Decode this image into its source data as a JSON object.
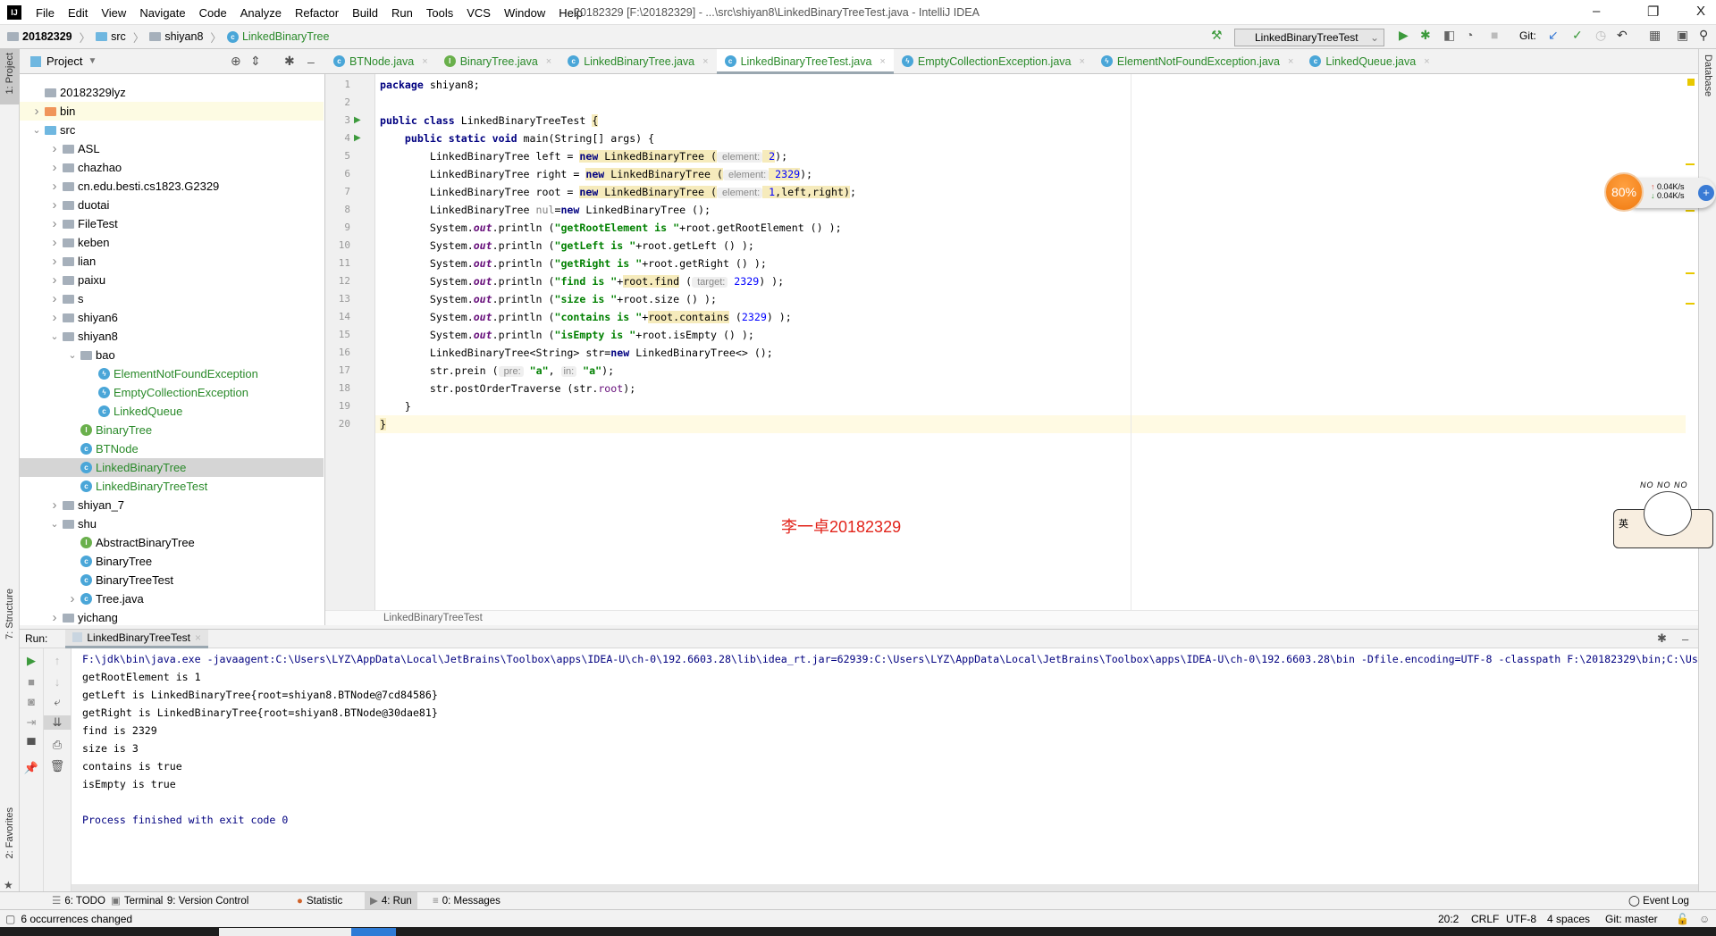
{
  "titlebar": {
    "logo": "IJ",
    "menus": [
      "File",
      "Edit",
      "View",
      "Navigate",
      "Code",
      "Analyze",
      "Refactor",
      "Build",
      "Run",
      "Tools",
      "VCS",
      "Window",
      "Help"
    ],
    "title": "20182329 [F:\\20182329] - ...\\src\\shiyan8\\LinkedBinaryTreeTest.java - IntelliJ IDEA",
    "controls": {
      "minimize": "–",
      "restore": "❐",
      "close": "X"
    }
  },
  "navbar": {
    "crumbs": [
      "20182329",
      "src",
      "shiyan8",
      "LinkedBinaryTree"
    ],
    "run_config": "LinkedBinaryTreeTest",
    "git_label": "Git:"
  },
  "sidebar": {
    "left_tools": [
      "1: Project",
      "7: Structure",
      "2: Favorites"
    ],
    "right_tools": [
      "Database"
    ]
  },
  "project": {
    "title": "Project",
    "items": [
      {
        "label": "20182329lyz",
        "depth": 1,
        "arrow": "",
        "icon": "folder"
      },
      {
        "label": "bin",
        "depth": 1,
        "arrow": "right",
        "icon": "folder-orange",
        "highlight": true
      },
      {
        "label": "src",
        "depth": 1,
        "arrow": "down",
        "icon": "folder-blue"
      },
      {
        "label": "ASL",
        "depth": 2,
        "arrow": "right",
        "icon": "package"
      },
      {
        "label": "chazhao",
        "depth": 2,
        "arrow": "right",
        "icon": "package"
      },
      {
        "label": "cn.edu.besti.cs1823.G2329",
        "depth": 2,
        "arrow": "right",
        "icon": "package"
      },
      {
        "label": "duotai",
        "depth": 2,
        "arrow": "right",
        "icon": "package"
      },
      {
        "label": "FileTest",
        "depth": 2,
        "arrow": "right",
        "icon": "package"
      },
      {
        "label": "keben",
        "depth": 2,
        "arrow": "right",
        "icon": "package"
      },
      {
        "label": "lian",
        "depth": 2,
        "arrow": "right",
        "icon": "package"
      },
      {
        "label": "paixu",
        "depth": 2,
        "arrow": "right",
        "icon": "package"
      },
      {
        "label": "s",
        "depth": 2,
        "arrow": "right",
        "icon": "package"
      },
      {
        "label": "shiyan6",
        "depth": 2,
        "arrow": "right",
        "icon": "package"
      },
      {
        "label": "shiyan8",
        "depth": 2,
        "arrow": "down",
        "icon": "package"
      },
      {
        "label": "bao",
        "depth": 3,
        "arrow": "down",
        "icon": "package"
      },
      {
        "label": "ElementNotFoundException",
        "depth": 4,
        "arrow": "",
        "icon": "exception",
        "green": true
      },
      {
        "label": "EmptyCollectionException",
        "depth": 4,
        "arrow": "",
        "icon": "exception",
        "green": true
      },
      {
        "label": "LinkedQueue",
        "depth": 4,
        "arrow": "",
        "icon": "class",
        "green": true
      },
      {
        "label": "BinaryTree",
        "depth": 3,
        "arrow": "",
        "icon": "interface",
        "green": true
      },
      {
        "label": "BTNode",
        "depth": 3,
        "arrow": "",
        "icon": "class",
        "green": true
      },
      {
        "label": "LinkedBinaryTree",
        "depth": 3,
        "arrow": "",
        "icon": "class",
        "green": true,
        "selected": true
      },
      {
        "label": "LinkedBinaryTreeTest",
        "depth": 3,
        "arrow": "",
        "icon": "test-class",
        "green": true
      },
      {
        "label": "shiyan_7",
        "depth": 2,
        "arrow": "right",
        "icon": "package"
      },
      {
        "label": "shu",
        "depth": 2,
        "arrow": "down",
        "icon": "package"
      },
      {
        "label": "AbstractBinaryTree",
        "depth": 3,
        "arrow": "",
        "icon": "interface"
      },
      {
        "label": "BinaryTree",
        "depth": 3,
        "arrow": "",
        "icon": "class"
      },
      {
        "label": "BinaryTreeTest",
        "depth": 3,
        "arrow": "",
        "icon": "test-class"
      },
      {
        "label": "Tree.java",
        "depth": 3,
        "arrow": "right",
        "icon": "class"
      },
      {
        "label": "yichang",
        "depth": 2,
        "arrow": "right",
        "icon": "package"
      }
    ]
  },
  "tabs": [
    {
      "label": "BTNode.java",
      "icon": "class"
    },
    {
      "label": "BinaryTree.java",
      "icon": "interface"
    },
    {
      "label": "LinkedBinaryTree.java",
      "icon": "class"
    },
    {
      "label": "LinkedBinaryTreeTest.java",
      "icon": "test-class",
      "active": true
    },
    {
      "label": "EmptyCollectionException.java",
      "icon": "exception"
    },
    {
      "label": "ElementNotFoundException.java",
      "icon": "exception"
    },
    {
      "label": "LinkedQueue.java",
      "icon": "class"
    }
  ],
  "editor": {
    "breadcrumb": "LinkedBinaryTreeTest",
    "caret_line": 20,
    "run_marker_lines": [
      3,
      4
    ],
    "lines": [
      [
        [
          "package",
          "kw"
        ],
        [
          " shiyan8;",
          ""
        ]
      ],
      [],
      [
        [
          "public class",
          "kw"
        ],
        [
          " LinkedBinaryTreeTest ",
          ""
        ],
        [
          "{",
          "hl"
        ]
      ],
      [
        [
          "    public static void",
          "kw"
        ],
        [
          " main(String[] args) {",
          ""
        ]
      ],
      [
        [
          "        LinkedBinaryTree left = ",
          ""
        ],
        [
          "new",
          "kw hl"
        ],
        [
          " LinkedBinaryTree (",
          "hl"
        ],
        [
          " element:",
          "hint"
        ],
        [
          " 2",
          "num hl"
        ],
        [
          ");",
          ""
        ]
      ],
      [
        [
          "        LinkedBinaryTree right = ",
          ""
        ],
        [
          "new",
          "kw hl"
        ],
        [
          " LinkedBinaryTree (",
          "hl"
        ],
        [
          " element:",
          "hint"
        ],
        [
          " 2329",
          "num hl"
        ],
        [
          ");",
          ""
        ]
      ],
      [
        [
          "        LinkedBinaryTree root = ",
          ""
        ],
        [
          "new",
          "kw hl"
        ],
        [
          " LinkedBinaryTree (",
          "hl"
        ],
        [
          " element:",
          "hint"
        ],
        [
          " 1",
          "num hl"
        ],
        [
          ",left,right)",
          "hl"
        ],
        [
          ";",
          ""
        ]
      ],
      [
        [
          "        LinkedBinaryTree ",
          ""
        ],
        [
          "nul",
          "unused"
        ],
        [
          "=",
          ""
        ],
        [
          "new",
          "kw"
        ],
        [
          " LinkedBinaryTree ();",
          ""
        ]
      ],
      [
        [
          "        System.",
          ""
        ],
        [
          "out",
          "out"
        ],
        [
          ".println (",
          ""
        ],
        [
          "\"getRootElement is \"",
          "str"
        ],
        [
          "+root.getRootElement () );",
          ""
        ]
      ],
      [
        [
          "        System.",
          ""
        ],
        [
          "out",
          "out"
        ],
        [
          ".println (",
          ""
        ],
        [
          "\"getLeft is \"",
          "str"
        ],
        [
          "+root.getLeft () );",
          ""
        ]
      ],
      [
        [
          "        System.",
          ""
        ],
        [
          "out",
          "out"
        ],
        [
          ".println (",
          ""
        ],
        [
          "\"getRight is \"",
          "str"
        ],
        [
          "+root.getRight () );",
          ""
        ]
      ],
      [
        [
          "        System.",
          ""
        ],
        [
          "out",
          "out"
        ],
        [
          ".println (",
          ""
        ],
        [
          "\"find is \"",
          "str"
        ],
        [
          "+",
          ""
        ],
        [
          "root.find",
          "hl"
        ],
        [
          " (",
          ""
        ],
        [
          " target:",
          "hint"
        ],
        [
          " 2329",
          "num"
        ],
        [
          ") );",
          ""
        ]
      ],
      [
        [
          "        System.",
          ""
        ],
        [
          "out",
          "out"
        ],
        [
          ".println (",
          ""
        ],
        [
          "\"size is \"",
          "str"
        ],
        [
          "+root.size () );",
          ""
        ]
      ],
      [
        [
          "        System.",
          ""
        ],
        [
          "out",
          "out"
        ],
        [
          ".println (",
          ""
        ],
        [
          "\"contains is \"",
          "str"
        ],
        [
          "+",
          ""
        ],
        [
          "root.contains",
          "hl"
        ],
        [
          " (",
          ""
        ],
        [
          "2329",
          "num"
        ],
        [
          ") );",
          ""
        ]
      ],
      [
        [
          "        System.",
          ""
        ],
        [
          "out",
          "out"
        ],
        [
          ".println (",
          ""
        ],
        [
          "\"isEmpty is \"",
          "str"
        ],
        [
          "+root.isEmpty () );",
          ""
        ]
      ],
      [
        [
          "        LinkedBinaryTree<String> str=",
          ""
        ],
        [
          "new",
          "kw"
        ],
        [
          " LinkedBinaryTree<> ();",
          ""
        ]
      ],
      [
        [
          "        str.prein (",
          ""
        ],
        [
          " pre:",
          "hint"
        ],
        [
          " ",
          ""
        ],
        [
          "\"a\"",
          "str"
        ],
        [
          ", ",
          ""
        ],
        [
          "in:",
          "hint"
        ],
        [
          " ",
          ""
        ],
        [
          "\"a\"",
          "str"
        ],
        [
          ");",
          ""
        ]
      ],
      [
        [
          "        str.postOrderTraverse (str.",
          ""
        ],
        [
          "root",
          "fld"
        ],
        [
          ");",
          ""
        ]
      ],
      [
        [
          "    }",
          ""
        ]
      ],
      [
        [
          "}",
          "hl"
        ]
      ]
    ],
    "watermark": "李一卓20182329"
  },
  "run": {
    "label": "Run:",
    "tab": "LinkedBinaryTreeTest",
    "output": [
      "F:\\jdk\\bin\\java.exe -javaagent:C:\\Users\\LYZ\\AppData\\Local\\JetBrains\\Toolbox\\apps\\IDEA-U\\ch-0\\192.6603.28\\lib\\idea_rt.jar=62939:C:\\Users\\LYZ\\AppData\\Local\\JetBrains\\Toolbox\\apps\\IDEA-U\\ch-0\\192.6603.28\\bin -Dfile.encoding=UTF-8 -classpath F:\\20182329\\bin;C:\\Us",
      "getRootElement is 1",
      "getLeft is LinkedBinaryTree{root=shiyan8.BTNode@7cd84586}",
      "getRight is LinkedBinaryTree{root=shiyan8.BTNode@30dae81}",
      "find is 2329",
      "size is 3",
      "contains is true",
      "isEmpty is true",
      "",
      "Process finished with exit code 0"
    ]
  },
  "bottom_tabs": [
    {
      "label": "6: TODO",
      "icon": "list-icon"
    },
    {
      "label": "Terminal",
      "icon": "terminal-icon"
    },
    {
      "label": "9: Version Control",
      "icon": "vcs-icon"
    },
    {
      "label": "Statistic",
      "icon": "statistic-icon"
    },
    {
      "label": "4: Run",
      "icon": "run-icon",
      "active": true
    },
    {
      "label": "0: Messages",
      "icon": "messages-icon"
    }
  ],
  "event_log": "Event Log",
  "status": {
    "message": "6 occurrences changed",
    "position": "20:2",
    "line_sep": "CRLF",
    "encoding": "UTF-8",
    "indent": "4 spaces",
    "git": "Git: master"
  },
  "overlay": {
    "cpu": "80%",
    "up": "0.04K/s",
    "down": "0.04K/s",
    "sticker_text": "NO NO NO",
    "sticker_char": "英"
  },
  "colors": {
    "keyword": "#000080",
    "string": "#008000",
    "number": "#0000ff",
    "watermark": "#e2231a",
    "accent_green": "#2a8a2a"
  }
}
